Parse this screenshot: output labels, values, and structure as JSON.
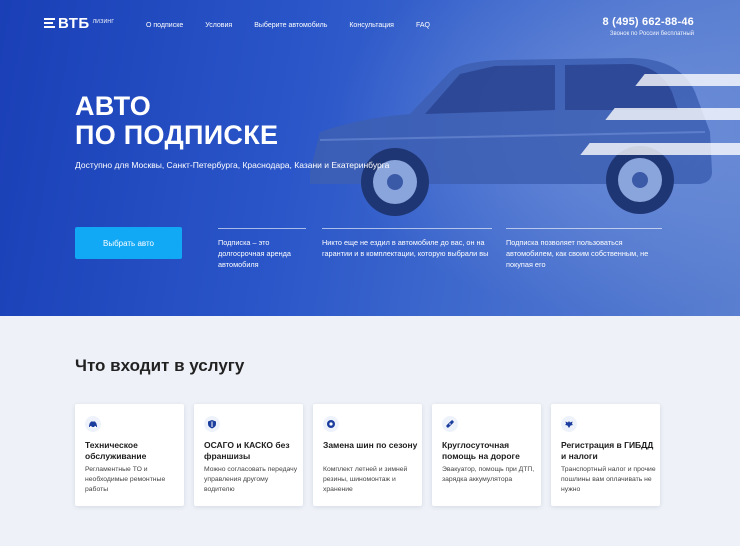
{
  "brand": {
    "logo_text": "ВТБ",
    "logo_sub": "ЛИЗИНГ"
  },
  "nav": {
    "items": [
      {
        "label": "О подписке"
      },
      {
        "label": "Условия"
      },
      {
        "label": "Выберите автомобиль"
      },
      {
        "label": "Консультация"
      },
      {
        "label": "FAQ"
      }
    ]
  },
  "contact": {
    "phone": "8 (495) 662-88-46",
    "note": "Звонок по России бесплатный"
  },
  "hero": {
    "title_line1": "АВТО",
    "title_line2": "ПО ПОДПИСКЕ",
    "subtitle": "Доступно для Москвы, Санкт-Петербурга, Краснодара, Казани и Екатеринбурга",
    "cta_label": "Выбрать авто",
    "facts": [
      {
        "text": "Подписка – это долгосрочная аренда автомобиля"
      },
      {
        "text": "Никто еще не ездил в автомобиле до вас, он на гарантии и в комплектации, которую выбрали вы"
      },
      {
        "text": "Подписка позволяет пользоваться автомобилем, как своим собственным, не покупая его"
      }
    ]
  },
  "services": {
    "title": "Что входит в услугу",
    "cards": [
      {
        "icon": "car-icon",
        "title": "Техническое обслуживание",
        "text": "Регламентные ТО и необходимые ремонтные работы"
      },
      {
        "icon": "shield-icon",
        "title": "ОСАГО и КАСКО без франшизы",
        "text": "Можно согласовать передачу управления другому водителю"
      },
      {
        "icon": "tire-icon",
        "title": "Замена шин по сезону",
        "text": "Комплект летней и зимней резины, шиномонтаж и хранение"
      },
      {
        "icon": "bandage-icon",
        "title": "Круглосуточная помощь на дороге",
        "text": "Эвакуатор, помощь при ДТП, зарядка аккумулятора"
      },
      {
        "icon": "emblem-icon",
        "title": "Регистрация в ГИБДД и налоги",
        "text": "Транспортный налог и прочие пошлины вам оплачивать не нужно"
      }
    ]
  },
  "colors": {
    "hero_blue": "#1a3fb6",
    "cta_blue": "#11a8f5",
    "page_bg": "#eef1f7",
    "icon_blue": "#1b3d9e"
  }
}
